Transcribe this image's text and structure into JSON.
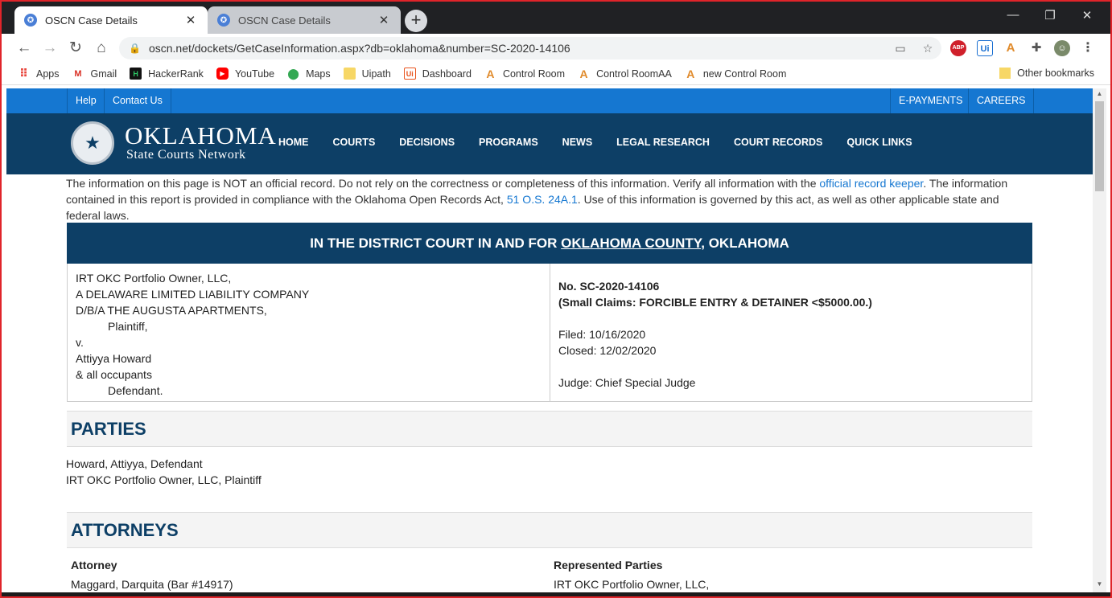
{
  "browser": {
    "tabs": [
      {
        "title": "OSCN Case Details",
        "active": true
      },
      {
        "title": "OSCN Case Details",
        "active": false
      }
    ],
    "url": "oscn.net/dockets/GetCaseInformation.aspx?db=oklahoma&number=SC-2020-14106",
    "bookmarks": [
      "Apps",
      "Gmail",
      "HackerRank",
      "YouTube",
      "Maps",
      "Uipath",
      "Dashboard",
      "Control Room",
      "Control RoomAA",
      "new Control Room"
    ],
    "other_bookmarks": "Other bookmarks"
  },
  "site": {
    "top_links_left": [
      "Help",
      "Contact Us"
    ],
    "top_links_right": [
      "E-PAYMENTS",
      "CAREERS"
    ],
    "brand_line1": "OKLAHOMA",
    "brand_line2": "State Courts Network",
    "nav": [
      "HOME",
      "COURTS",
      "DECISIONS",
      "PROGRAMS",
      "NEWS",
      "LEGAL RESEARCH",
      "COURT RECORDS",
      "QUICK LINKS"
    ]
  },
  "disclaimer": {
    "part1": "The information on this page is NOT an official record. Do not rely on the correctness or completeness of this information. Verify all information with the ",
    "link1": "official record keeper",
    "part2": ". The information contained in this report is provided in compliance with the Oklahoma Open Records Act, ",
    "link2": "51 O.S. 24A.1",
    "part3": ". Use of this information is governed by this act, as well as other applicable state and federal laws."
  },
  "court": {
    "prefix": "IN THE DISTRICT COURT IN AND FOR ",
    "county": "OKLAHOMA COUNTY",
    "suffix": ", OKLAHOMA"
  },
  "case": {
    "style_lines": [
      "IRT OKC Portfolio Owner, LLC,",
      "A DELAWARE LIMITED LIABILITY COMPANY",
      "D/B/A THE AUGUSTA APARTMENTS,"
    ],
    "plaintiff_role": "Plaintiff,",
    "versus": "v.",
    "defendant_lines": [
      "Attiyya Howard",
      "& all occupants"
    ],
    "defendant_role": "Defendant.",
    "number": "No. SC-2020-14106",
    "type": "(Small Claims: FORCIBLE ENTRY & DETAINER <$5000.00.)",
    "filed": "Filed: 10/16/2020",
    "closed": "Closed: 12/02/2020",
    "judge": "Judge: Chief Special Judge"
  },
  "parties": {
    "heading": "PARTIES",
    "items": [
      "Howard,  Attiyya, Defendant",
      "IRT OKC Portfolio Owner, LLC, Plaintiff"
    ]
  },
  "attorneys": {
    "heading": "ATTORNEYS",
    "col1_header": "Attorney",
    "col2_header": "Represented Parties",
    "row1_attorney": "Maggard,  Darquita (Bar #14917)",
    "row1_parties": "IRT OKC Portfolio Owner, LLC,"
  }
}
